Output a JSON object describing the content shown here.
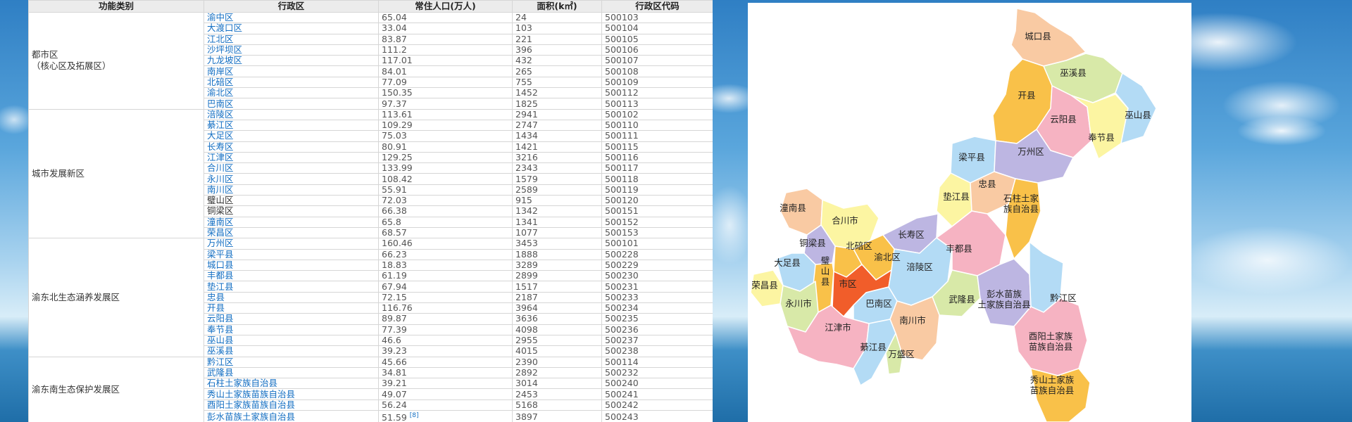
{
  "table": {
    "headers": [
      "功能类别",
      "行政区",
      "常住人口(万人)",
      "面积(k㎡)",
      "行政区代码"
    ],
    "groups": [
      {
        "category": "都市区\n（核心区及拓展区）",
        "rows": [
          {
            "name": "渝中区",
            "pop": "65.04",
            "area": "24",
            "code": "500103"
          },
          {
            "name": "大渡口区",
            "pop": "33.04",
            "area": "103",
            "code": "500104"
          },
          {
            "name": "江北区",
            "pop": "83.87",
            "area": "221",
            "code": "500105"
          },
          {
            "name": "沙坪坝区",
            "pop": "111.2",
            "area": "396",
            "code": "500106"
          },
          {
            "name": "九龙坡区",
            "pop": "117.01",
            "area": "432",
            "code": "500107"
          },
          {
            "name": "南岸区",
            "pop": "84.01",
            "area": "265",
            "code": "500108"
          },
          {
            "name": "北碚区",
            "pop": "77.09",
            "area": "755",
            "code": "500109"
          },
          {
            "name": "渝北区",
            "pop": "150.35",
            "area": "1452",
            "code": "500112"
          },
          {
            "name": "巴南区",
            "pop": "97.37",
            "area": "1825",
            "code": "500113"
          }
        ]
      },
      {
        "category": "城市发展新区",
        "rows": [
          {
            "name": "涪陵区",
            "pop": "113.61",
            "area": "2941",
            "code": "500102"
          },
          {
            "name": "綦江区",
            "pop": "109.29",
            "area": "2747",
            "code": "500110"
          },
          {
            "name": "大足区",
            "pop": "75.03",
            "area": "1434",
            "code": "500111"
          },
          {
            "name": "长寿区",
            "pop": "80.91",
            "area": "1421",
            "code": "500115"
          },
          {
            "name": "江津区",
            "pop": "129.25",
            "area": "3216",
            "code": "500116"
          },
          {
            "name": "合川区",
            "pop": "133.99",
            "area": "2343",
            "code": "500117"
          },
          {
            "name": "永川区",
            "pop": "108.42",
            "area": "1579",
            "code": "500118"
          },
          {
            "name": "南川区",
            "pop": "55.91",
            "area": "2589",
            "code": "500119"
          },
          {
            "name": "璧山区",
            "pop": "72.03",
            "area": "915",
            "code": "500120",
            "plain": true
          },
          {
            "name": "铜梁区",
            "pop": "66.38",
            "area": "1342",
            "code": "500151",
            "plain": true
          },
          {
            "name": "潼南区",
            "pop": "65.8",
            "area": "1341",
            "code": "500152"
          },
          {
            "name": "荣昌区",
            "pop": "68.57",
            "area": "1077",
            "code": "500153"
          }
        ]
      },
      {
        "category": "渝东北生态涵养发展区",
        "rows": [
          {
            "name": "万州区",
            "pop": "160.46",
            "area": "3453",
            "code": "500101"
          },
          {
            "name": "梁平县",
            "pop": "66.23",
            "area": "1888",
            "code": "500228"
          },
          {
            "name": "城口县",
            "pop": "18.83",
            "area": "3289",
            "code": "500229"
          },
          {
            "name": "丰都县",
            "pop": "61.19",
            "area": "2899",
            "code": "500230"
          },
          {
            "name": "垫江县",
            "pop": "67.94",
            "area": "1517",
            "code": "500231"
          },
          {
            "name": "忠县",
            "pop": "72.15",
            "area": "2187",
            "code": "500233"
          },
          {
            "name": "开县",
            "pop": "116.76",
            "area": "3964",
            "code": "500234"
          },
          {
            "name": "云阳县",
            "pop": "89.87",
            "area": "3636",
            "code": "500235"
          },
          {
            "name": "奉节县",
            "pop": "77.39",
            "area": "4098",
            "code": "500236"
          },
          {
            "name": "巫山县",
            "pop": "46.6",
            "area": "2955",
            "code": "500237"
          },
          {
            "name": "巫溪县",
            "pop": "39.23",
            "area": "4015",
            "code": "500238"
          }
        ]
      },
      {
        "category": "渝东南生态保护发展区",
        "rows": [
          {
            "name": "黔江区",
            "pop": "45.66",
            "area": "2390",
            "code": "500114"
          },
          {
            "name": "武隆县",
            "pop": "34.81",
            "area": "2892",
            "code": "500232"
          },
          {
            "name": "石柱土家族自治县",
            "pop": "39.21",
            "area": "3014",
            "code": "500240"
          },
          {
            "name": "秀山土家族苗族自治县",
            "pop": "49.07",
            "area": "2453",
            "code": "500241"
          },
          {
            "name": "酉阳土家族苗族自治县",
            "pop": "56.24",
            "area": "5168",
            "code": "500242"
          },
          {
            "name": "彭水苗族土家族自治县",
            "pop": "51.59",
            "area": "3897",
            "code": "500243",
            "ref": "[8]"
          }
        ]
      }
    ]
  },
  "map": {
    "labels": [
      "城口县",
      "巫溪县",
      "开县",
      "云阳县",
      "巫山县",
      "奉节县",
      "梁平县",
      "万州区",
      "垫江县",
      "忠县",
      "石柱土家\n族自治县",
      "潼南县",
      "合川市",
      "铜梁县",
      "北碚区",
      "渝北区",
      "长寿区",
      "大足县",
      "璧\n山\n县",
      "市区",
      "荣昌县",
      "永川市",
      "巴南区",
      "涪陵区",
      "丰都县",
      "武隆县",
      "彭水苗族\n土家族自治县",
      "黔江区",
      "江津市",
      "南川市",
      "綦江县",
      "万盛区",
      "酉阳土家族\n苗族自治县",
      "秀山土家族\n苗族自治县"
    ],
    "colors": {
      "orange": "#f9c149",
      "green": "#d8e9a8",
      "pink": "#f6b3c2",
      "yellow": "#fcf5a2",
      "blue": "#b3dbf5",
      "purple": "#bdb6e2",
      "peach": "#f9caa3",
      "red": "#f15d2a"
    }
  }
}
